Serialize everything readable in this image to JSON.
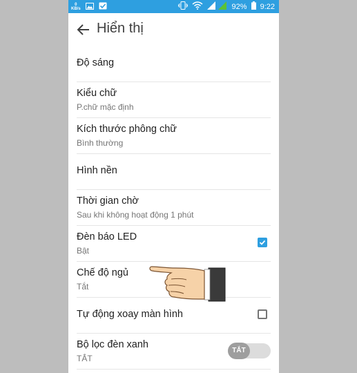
{
  "status_bar": {
    "speed_value": "0",
    "speed_unit": "KB/s",
    "battery": "92%",
    "time": "9:22",
    "color": "#2e9fe0",
    "icons": [
      "image-icon",
      "check-icon",
      "vibrate-icon",
      "wifi-icon",
      "signal-icon",
      "battery-icon"
    ]
  },
  "header": {
    "title": "Hiển thị"
  },
  "settings": [
    {
      "label": "Độ sáng"
    },
    {
      "label": "Kiểu chữ",
      "sub": "P.chữ mặc định"
    },
    {
      "label": "Kích thước phông chữ",
      "sub": "Bình thường"
    },
    {
      "label": "Hình nền"
    },
    {
      "label": "Thời gian chờ",
      "sub": "Sau khi không hoạt động 1 phút"
    },
    {
      "label": "Đèn báo LED",
      "sub": "Bật",
      "checked": true
    },
    {
      "label": "Chế độ ngủ",
      "sub": "Tắt"
    },
    {
      "label": "Tự động xoay màn hình",
      "checked": false
    },
    {
      "label": "Bộ lọc đèn xanh",
      "sub": "TẮT",
      "toggle_label": "TẮT"
    }
  ]
}
